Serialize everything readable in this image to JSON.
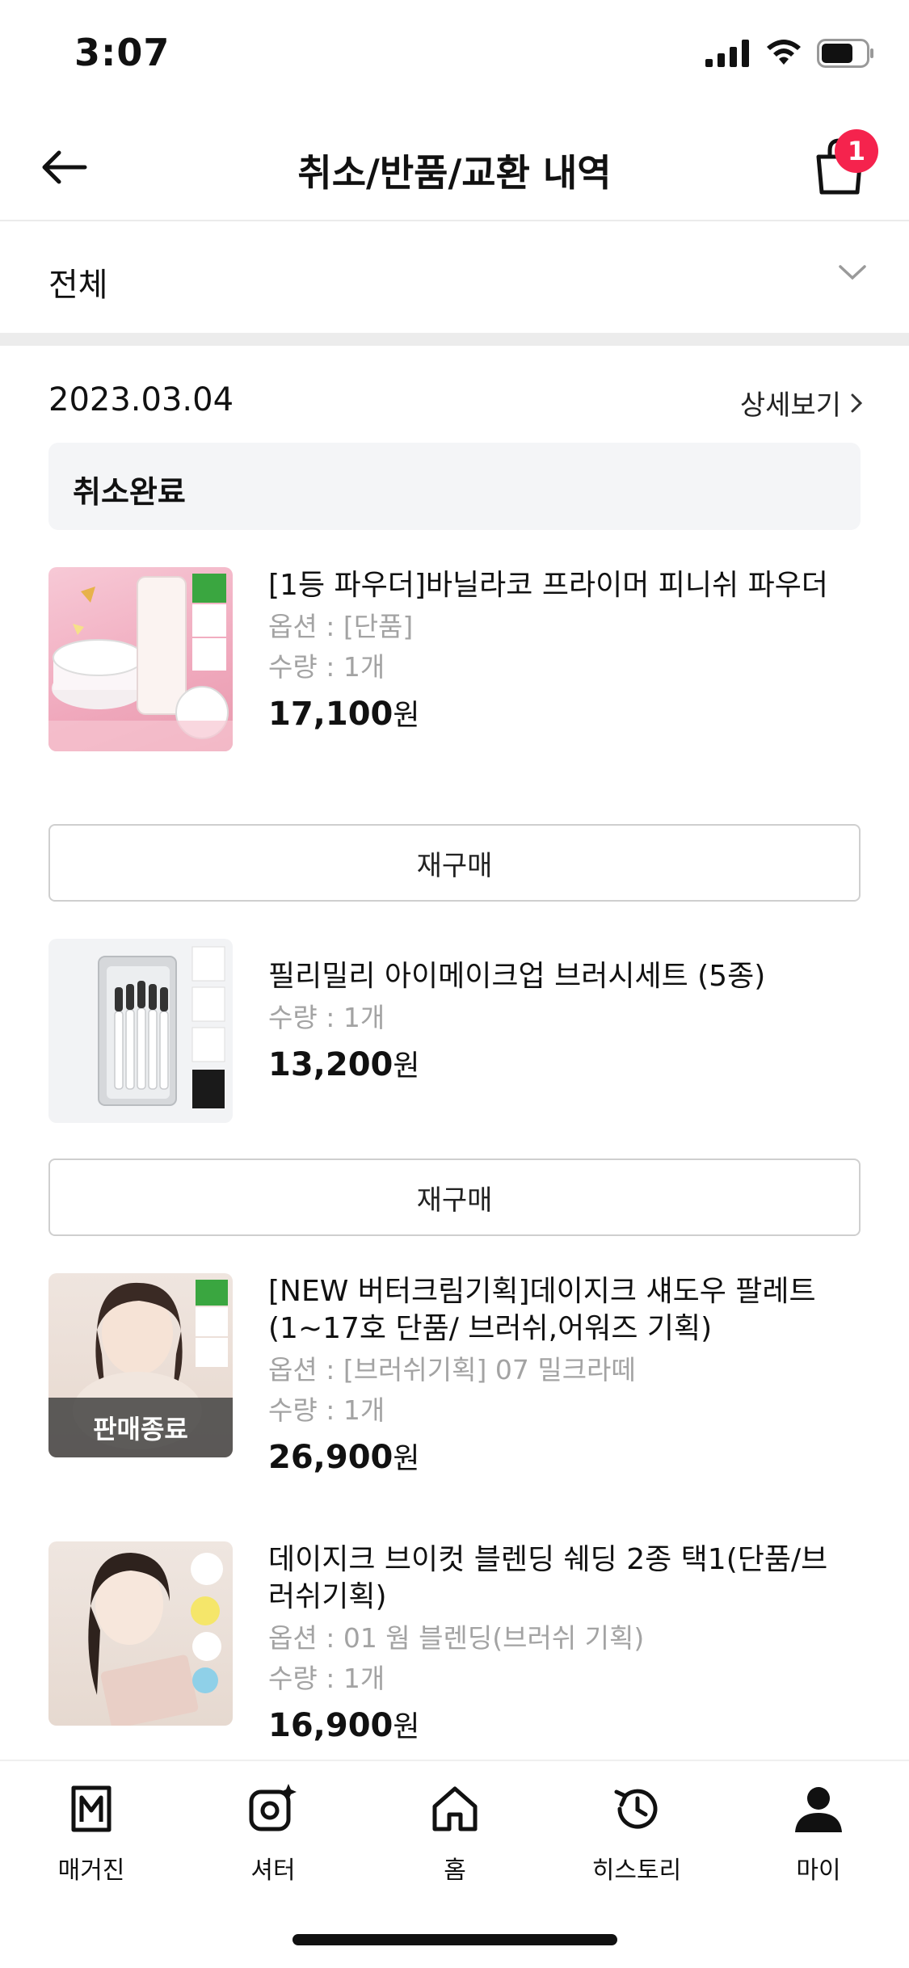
{
  "status_bar": {
    "time": "3:07"
  },
  "header": {
    "title": "취소/반품/교환 내역",
    "cart_count": "1"
  },
  "filter": {
    "selected": "전체"
  },
  "order": {
    "date": "2023.03.04",
    "detail_link": "상세보기",
    "status": "취소완료",
    "items": [
      {
        "name": "[1등 파우더]바닐라코 프라이머 피니쉬 파우더",
        "option": "옵션 : [단품]",
        "quantity": "수량 : 1개",
        "price": "17,100",
        "unit": "원",
        "rebuy": "재구매"
      },
      {
        "name": "필리밀리 아이메이크업 브러시세트 (5종)",
        "quantity": "수량 : 1개",
        "price": "13,200",
        "unit": "원",
        "rebuy": "재구매"
      },
      {
        "name": "[NEW 버터크림기획]데이지크 섀도우 팔레트 (1~17호 단품/ 브러쉬,어워즈 기획)",
        "option": "옵션 : [브러쉬기획] 07 밀크라떼",
        "quantity": "수량 : 1개",
        "price": "26,900",
        "unit": "원",
        "badge": "판매종료"
      },
      {
        "name": "데이지크 브이컷 블렌딩 쉐딩 2종 택1(단품/브러쉬기획)",
        "option": "옵션 : 01 웜 블렌딩(브러쉬 기획)",
        "quantity": "수량 : 1개",
        "price": "16,900",
        "unit": "원"
      }
    ]
  },
  "bottom_nav": [
    {
      "label": "매거진",
      "icon": "magazine-icon"
    },
    {
      "label": "셔터",
      "icon": "shutter-icon"
    },
    {
      "label": "홈",
      "icon": "home-icon"
    },
    {
      "label": "히스토리",
      "icon": "history-icon"
    },
    {
      "label": "마이",
      "icon": "my-icon"
    }
  ],
  "colors": {
    "badge": "#f5234d",
    "muted_text": "#a3a3a3",
    "status_bg": "#f4f5f7"
  }
}
